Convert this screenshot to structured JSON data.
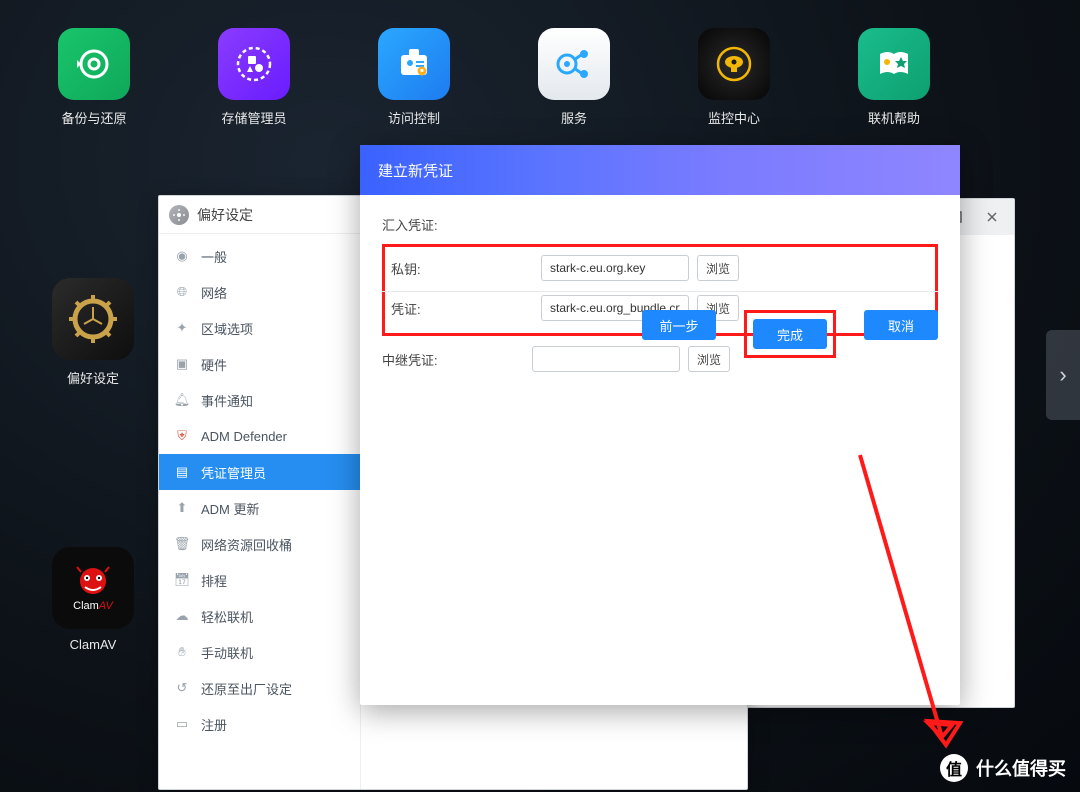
{
  "desktop": {
    "row": [
      {
        "name": "backup-restore",
        "label": "备份与还原",
        "bg": "linear-gradient(135deg,#19c56b,#0fa85a)",
        "icon": "restore"
      },
      {
        "name": "storage-manager",
        "label": "存储管理员",
        "bg": "linear-gradient(135deg,#8a3cff,#6a1cff)",
        "icon": "shapes"
      },
      {
        "name": "access-control",
        "label": "访问控制",
        "bg": "linear-gradient(135deg,#2aa8ff,#1e7cf0)",
        "icon": "idcard"
      },
      {
        "name": "services",
        "label": "服务",
        "bg": "linear-gradient(135deg,#ffffff,#e8ecef)",
        "icon": "nodes"
      },
      {
        "name": "surveillance",
        "label": "监控中心",
        "bg": "radial-gradient(circle,#2a2a2a,#0a0a0a)",
        "icon": "camera"
      },
      {
        "name": "online-help",
        "label": "联机帮助",
        "bg": "linear-gradient(135deg,#1abc8c,#0ea070)",
        "icon": "book"
      }
    ],
    "col": [
      {
        "name": "preferences",
        "label": "偏好设定",
        "bg": "linear-gradient(135deg,#2b2b2b,#0e0e0e)",
        "icon": "gear"
      },
      {
        "name": "clamav",
        "label": "ClamAV",
        "bg": "#0b0b0b",
        "icon": "clam"
      }
    ]
  },
  "prefs_window": {
    "title": "偏好设定",
    "sidebar": [
      {
        "label": "一般",
        "icon": "cog",
        "key": "general"
      },
      {
        "label": "网络",
        "icon": "globe",
        "key": "network"
      },
      {
        "label": "区域选项",
        "icon": "region",
        "key": "region"
      },
      {
        "label": "硬件",
        "icon": "chip",
        "key": "hardware"
      },
      {
        "label": "事件通知",
        "icon": "bell",
        "key": "notify"
      },
      {
        "label": "ADM Defender",
        "icon": "shield",
        "key": "defender"
      },
      {
        "label": "凭证管理员",
        "icon": "cert",
        "key": "certmgr",
        "active": true
      },
      {
        "label": "ADM 更新",
        "icon": "update",
        "key": "update"
      },
      {
        "label": "网络资源回收桶",
        "icon": "trash",
        "key": "recycle"
      },
      {
        "label": "排程",
        "icon": "calendar",
        "key": "schedule"
      },
      {
        "label": "轻松联机",
        "icon": "cloud",
        "key": "ezconnect"
      },
      {
        "label": "手动联机",
        "icon": "hand",
        "key": "manual"
      },
      {
        "label": "还原至出厂设定",
        "icon": "factory",
        "key": "factory"
      },
      {
        "label": "注册",
        "icon": "register",
        "key": "register"
      }
    ]
  },
  "modal": {
    "title": "建立新凭证",
    "section": "汇入凭证:",
    "rows": {
      "key": {
        "label": "私钥:",
        "value": "stark-c.eu.org.key",
        "browse": "浏览"
      },
      "cert": {
        "label": "凭证:",
        "value": "stark-c.eu.org_bundle.crt",
        "browse": "浏览"
      },
      "intermediate": {
        "label": "中继凭证:",
        "value": "",
        "browse": "浏览"
      }
    },
    "buttons": {
      "prev": "前一步",
      "finish": "完成",
      "cancel": "取消"
    }
  },
  "back_window": {
    "max_tip": "maximize",
    "close_tip": "close"
  },
  "watermark": {
    "glyph": "值",
    "text": "什么值得买"
  }
}
